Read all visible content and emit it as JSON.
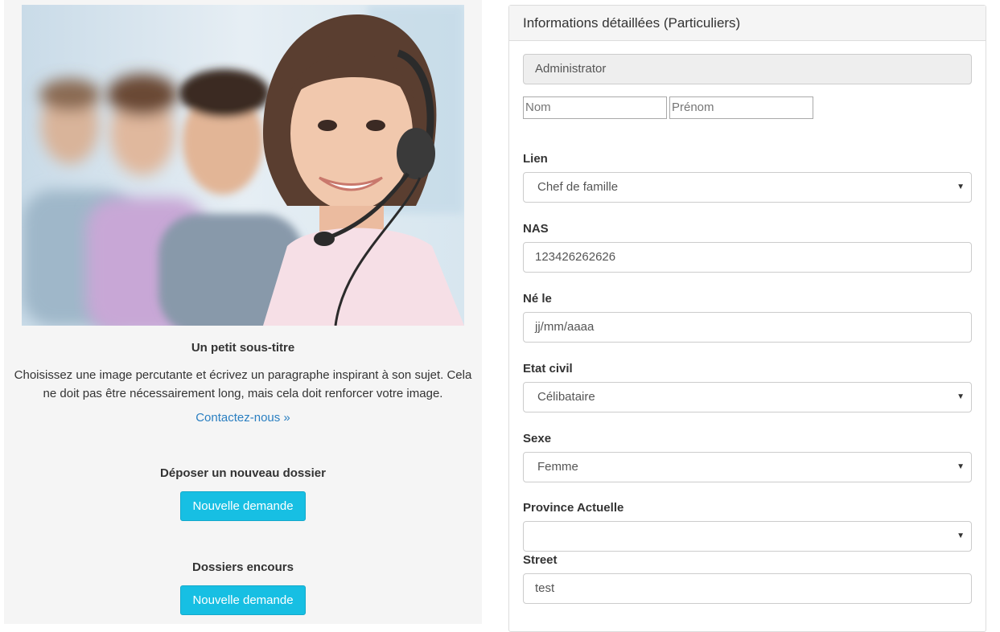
{
  "left": {
    "hero_alt": "customer service headset photo",
    "subtitle": "Un petit sous-titre",
    "paragraph_line1": "Choisissez une image percutante et écrivez un paragraphe inspirant à son sujet. Cela",
    "paragraph_line2": "ne doit pas être nécessairement long, mais cela doit renforcer votre image.",
    "contact_link": "Contactez-nous »",
    "new_file_heading": "Déposer un nouveau dossier",
    "new_file_button": "Nouvelle demande",
    "ongoing_heading": "Dossiers encours",
    "ongoing_button": "Nouvelle demande"
  },
  "panel": {
    "title": "Informations détaillées (Particuliers)",
    "user_field": "Administrator",
    "nom_placeholder": "Nom",
    "prenom_placeholder": "Prénom",
    "lien": {
      "label": "Lien",
      "value": "Chef de famille"
    },
    "nas": {
      "label": "NAS",
      "value": "123426262626"
    },
    "ne_le": {
      "label": "Né le",
      "value": "jj/mm/aaaa"
    },
    "etat_civil": {
      "label": "Etat civil",
      "value": "Célibataire"
    },
    "sexe": {
      "label": "Sexe",
      "value": "Femme"
    },
    "province": {
      "label": "Province Actuelle",
      "value": ""
    },
    "street": {
      "label": "Street",
      "value": "test"
    }
  },
  "colors": {
    "button_info": "#17bfe3",
    "link": "#2a7fc1",
    "left_bg": "#f5f5f5"
  },
  "icons": {
    "select_caret": "caret-down-icon"
  }
}
